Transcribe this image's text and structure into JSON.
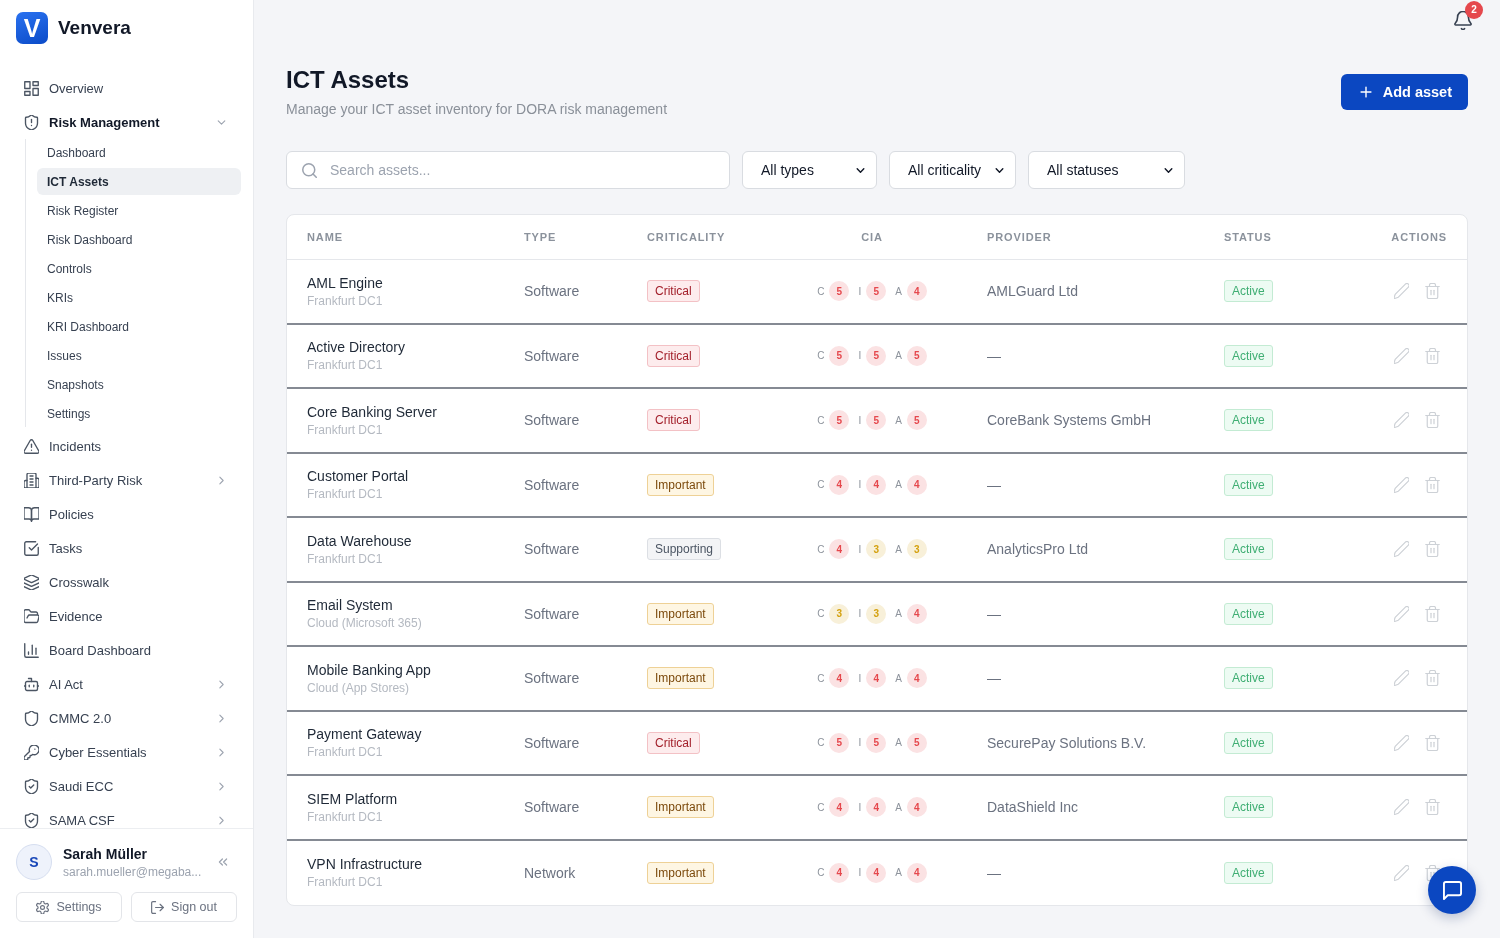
{
  "sidebar": {
    "logo_mark": "V",
    "brand": "Venvera",
    "nav": [
      {
        "label": "Overview",
        "selected": false
      },
      {
        "label": "Risk Management",
        "selected": false,
        "expanded": true,
        "children": [
          {
            "label": "Dashboard",
            "selected": false
          },
          {
            "label": "ICT Assets",
            "selected": true
          },
          {
            "label": "Risk Register",
            "selected": false
          },
          {
            "label": "Risk Dashboard",
            "selected": false
          },
          {
            "label": "Controls",
            "selected": false
          },
          {
            "label": "KRIs",
            "selected": false
          },
          {
            "label": "KRI Dashboard",
            "selected": false
          },
          {
            "label": "Issues",
            "selected": false
          },
          {
            "label": "Snapshots",
            "selected": false
          },
          {
            "label": "Settings",
            "selected": false
          }
        ]
      },
      {
        "label": "Incidents",
        "selected": false
      },
      {
        "label": "Third-Party Risk",
        "selected": false,
        "expanded": false
      },
      {
        "label": "Policies",
        "selected": false
      },
      {
        "label": "Tasks",
        "selected": false
      },
      {
        "label": "Crosswalk",
        "selected": false
      },
      {
        "label": "Evidence",
        "selected": false
      },
      {
        "label": "Board Dashboard",
        "selected": false
      },
      {
        "label": "AI Act",
        "selected": false,
        "expanded": false
      },
      {
        "label": "CMMC 2.0",
        "selected": false,
        "expanded": false
      },
      {
        "label": "Cyber Essentials",
        "selected": false,
        "expanded": false
      },
      {
        "label": "Saudi ECC",
        "selected": false,
        "expanded": false
      },
      {
        "label": "SAMA CSF",
        "selected": false,
        "expanded": false
      }
    ],
    "user": {
      "initial": "S",
      "name": "Sarah Müller",
      "email": "sarah.mueller@megaba..."
    },
    "footer_buttons": [
      "Settings",
      "Sign out"
    ]
  },
  "header": {
    "notification_count": "2",
    "title": "ICT Assets",
    "subtitle": "Manage your ICT asset inventory for DORA risk management",
    "add_button": "Add asset"
  },
  "filters": {
    "search": {
      "placeholder": "Search assets..."
    },
    "selects": [
      "All types",
      "All criticality",
      "All statuses"
    ]
  },
  "table": {
    "columns": [
      "NAME",
      "TYPE",
      "CRITICALITY",
      "CIA",
      "PROVIDER",
      "STATUS",
      "ACTIONS"
    ],
    "rows": [
      {
        "name": "AML Engine",
        "location": "Frankfurt DC1",
        "type": "Software",
        "criticality": {
          "label": "Critical",
          "kind": "critical"
        },
        "cia": [
          {
            "letter": "C",
            "score": "5",
            "color": "#e5484d"
          },
          {
            "letter": "I",
            "score": "5",
            "color": "#e5484d"
          },
          {
            "letter": "A",
            "score": "4",
            "color": "#e5484d"
          }
        ],
        "provider": "AMLGuard Ltd",
        "status": "Active"
      },
      {
        "name": "Active Directory",
        "location": "Frankfurt DC1",
        "type": "Software",
        "criticality": {
          "label": "Critical",
          "kind": "critical"
        },
        "cia": [
          {
            "letter": "C",
            "score": "5",
            "color": "#e5484d"
          },
          {
            "letter": "I",
            "score": "5",
            "color": "#e5484d"
          },
          {
            "letter": "A",
            "score": "5",
            "color": "#e5484d"
          }
        ],
        "provider": "—",
        "status": "Active"
      },
      {
        "name": "Core Banking Server",
        "location": "Frankfurt DC1",
        "type": "Software",
        "criticality": {
          "label": "Critical",
          "kind": "critical"
        },
        "cia": [
          {
            "letter": "C",
            "score": "5",
            "color": "#e5484d"
          },
          {
            "letter": "I",
            "score": "5",
            "color": "#e5484d"
          },
          {
            "letter": "A",
            "score": "5",
            "color": "#e5484d"
          }
        ],
        "provider": "CoreBank Systems GmbH",
        "status": "Active"
      },
      {
        "name": "Customer Portal",
        "location": "Frankfurt DC1",
        "type": "Software",
        "criticality": {
          "label": "Important",
          "kind": "important"
        },
        "cia": [
          {
            "letter": "C",
            "score": "4",
            "color": "#e5484d"
          },
          {
            "letter": "I",
            "score": "4",
            "color": "#e5484d"
          },
          {
            "letter": "A",
            "score": "4",
            "color": "#e5484d"
          }
        ],
        "provider": "—",
        "status": "Active"
      },
      {
        "name": "Data Warehouse",
        "location": "Frankfurt DC1",
        "type": "Software",
        "criticality": {
          "label": "Supporting",
          "kind": "supporting"
        },
        "cia": [
          {
            "letter": "C",
            "score": "4",
            "color": "#e5484d"
          },
          {
            "letter": "I",
            "score": "3",
            "color": "#d4a10f"
          },
          {
            "letter": "A",
            "score": "3",
            "color": "#d4a10f"
          }
        ],
        "provider": "AnalyticsPro Ltd",
        "status": "Active"
      },
      {
        "name": "Email System",
        "location": "Cloud (Microsoft 365)",
        "type": "Software",
        "criticality": {
          "label": "Important",
          "kind": "important"
        },
        "cia": [
          {
            "letter": "C",
            "score": "3",
            "color": "#d4a10f"
          },
          {
            "letter": "I",
            "score": "3",
            "color": "#d4a10f"
          },
          {
            "letter": "A",
            "score": "4",
            "color": "#e5484d"
          }
        ],
        "provider": "—",
        "status": "Active"
      },
      {
        "name": "Mobile Banking App",
        "location": "Cloud (App Stores)",
        "type": "Software",
        "criticality": {
          "label": "Important",
          "kind": "important"
        },
        "cia": [
          {
            "letter": "C",
            "score": "4",
            "color": "#e5484d"
          },
          {
            "letter": "I",
            "score": "4",
            "color": "#e5484d"
          },
          {
            "letter": "A",
            "score": "4",
            "color": "#e5484d"
          }
        ],
        "provider": "—",
        "status": "Active"
      },
      {
        "name": "Payment Gateway",
        "location": "Frankfurt DC1",
        "type": "Software",
        "criticality": {
          "label": "Critical",
          "kind": "critical"
        },
        "cia": [
          {
            "letter": "C",
            "score": "5",
            "color": "#e5484d"
          },
          {
            "letter": "I",
            "score": "5",
            "color": "#e5484d"
          },
          {
            "letter": "A",
            "score": "5",
            "color": "#e5484d"
          }
        ],
        "provider": "SecurePay Solutions B.V.",
        "status": "Active"
      },
      {
        "name": "SIEM Platform",
        "location": "Frankfurt DC1",
        "type": "Software",
        "criticality": {
          "label": "Important",
          "kind": "important"
        },
        "cia": [
          {
            "letter": "C",
            "score": "4",
            "color": "#e5484d"
          },
          {
            "letter": "I",
            "score": "4",
            "color": "#e5484d"
          },
          {
            "letter": "A",
            "score": "4",
            "color": "#e5484d"
          }
        ],
        "provider": "DataShield Inc",
        "status": "Active"
      },
      {
        "name": "VPN Infrastructure",
        "location": "Frankfurt DC1",
        "type": "Network",
        "criticality": {
          "label": "Important",
          "kind": "important"
        },
        "cia": [
          {
            "letter": "C",
            "score": "4",
            "color": "#e5484d"
          },
          {
            "letter": "I",
            "score": "4",
            "color": "#e5484d"
          },
          {
            "letter": "A",
            "score": "4",
            "color": "#e5484d"
          }
        ],
        "provider": "—",
        "status": "Active"
      }
    ]
  }
}
